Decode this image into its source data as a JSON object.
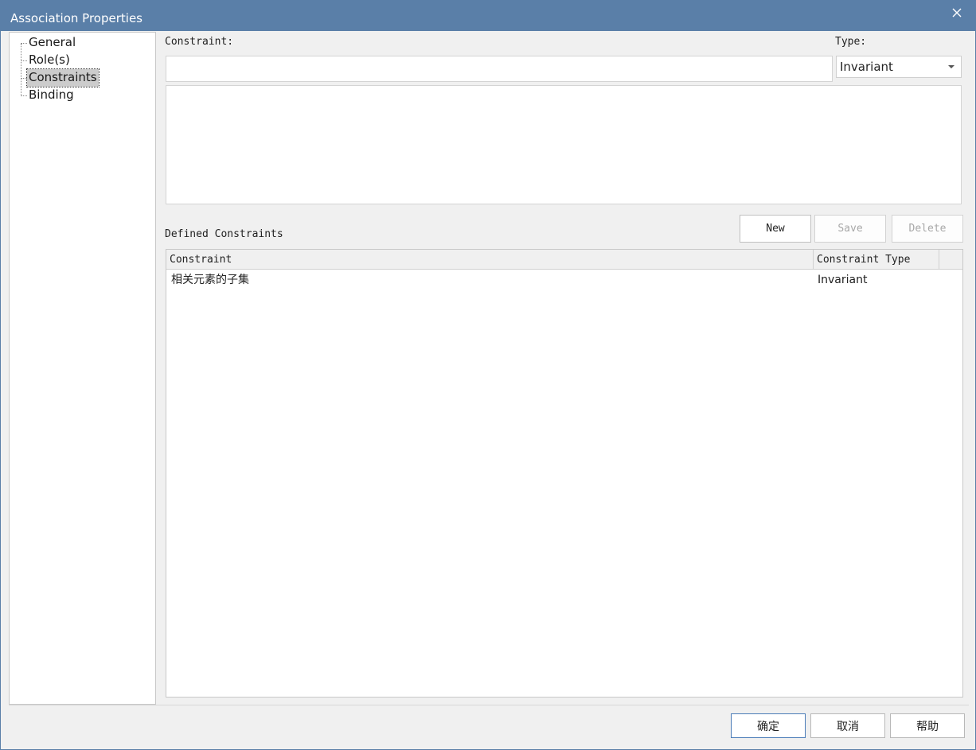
{
  "window": {
    "title": "Association Properties"
  },
  "tree": {
    "items": [
      {
        "label": "General",
        "selected": false
      },
      {
        "label": "Role(s)",
        "selected": false
      },
      {
        "label": "Constraints",
        "selected": true
      },
      {
        "label": "Binding",
        "selected": false
      }
    ]
  },
  "form": {
    "constraint_label": "Constraint:",
    "constraint_value": "",
    "type_label": "Type:",
    "type_value": "Invariant",
    "notes_value": ""
  },
  "defined": {
    "heading": "Defined Constraints",
    "buttons": {
      "new": "New",
      "save": "Save",
      "delete": "Delete"
    },
    "columns": [
      "Constraint",
      "Constraint Type"
    ],
    "rows": [
      {
        "constraint": "相关元素的子集",
        "type": "Invariant"
      }
    ]
  },
  "footer": {
    "ok": "确定",
    "cancel": "取消",
    "help": "帮助"
  },
  "colors": {
    "titlebar": "#5a7fa8",
    "background": "#f0f0f0",
    "selection": "#cccccc"
  }
}
